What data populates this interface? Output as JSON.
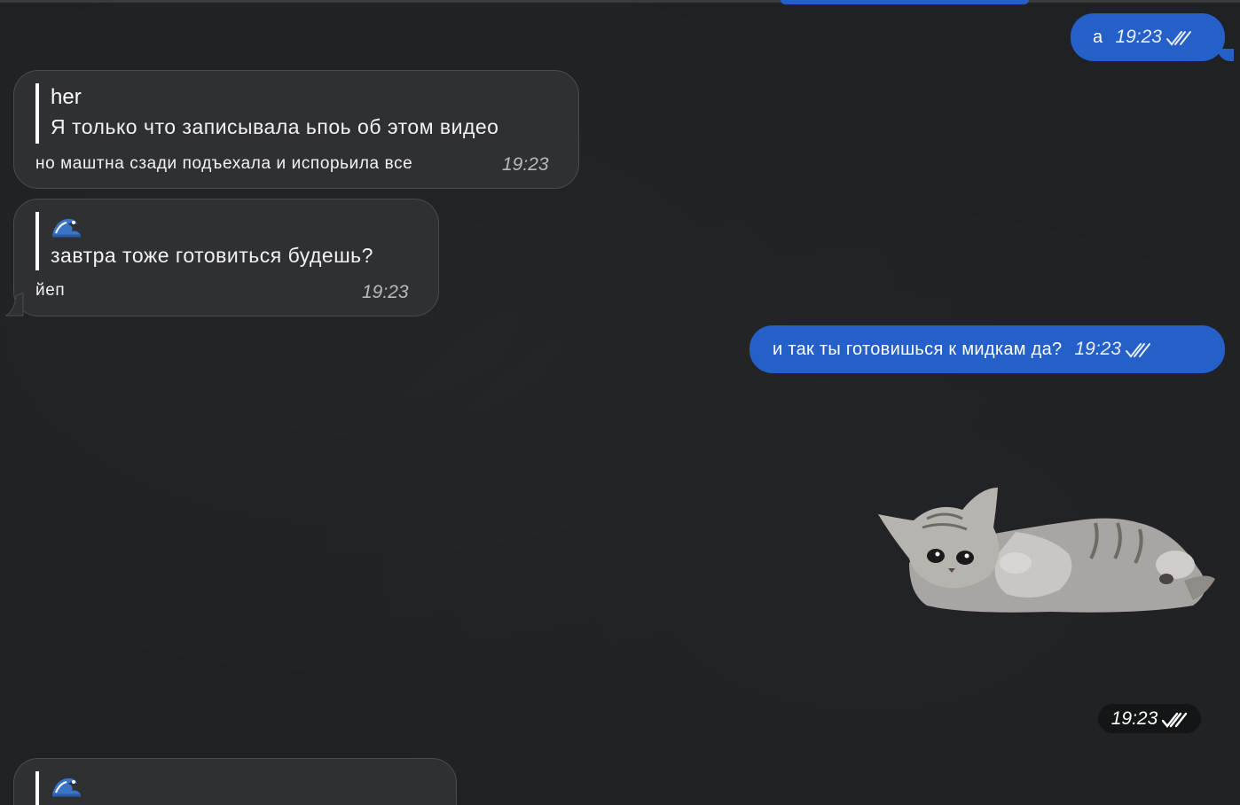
{
  "colors": {
    "background": "#1f2124",
    "outgoing_bubble": "#2460c8",
    "incoming_bubble": "#2f3033",
    "incoming_border": "#4a4b4f",
    "time_incoming": "#b8b9bd"
  },
  "messages": [
    {
      "direction": "outgoing",
      "text": "а",
      "time": "19:23",
      "status_icon": "double-check-icon"
    },
    {
      "direction": "incoming",
      "reply": {
        "author": "her",
        "text": "Я только что записывала ьпоь об этом видео"
      },
      "text": "но маштна сзади подъехала и испорьила все",
      "time": "19:23"
    },
    {
      "direction": "incoming",
      "reply": {
        "author_icon": "wave-emoji",
        "text": "завтра тоже готовиться будешь?"
      },
      "text": "йеп",
      "time": "19:23"
    },
    {
      "direction": "outgoing",
      "text": "и так ты готовишься к мидкам да?",
      "time": "19:23",
      "status_icon": "double-check-icon"
    },
    {
      "direction": "outgoing",
      "type": "sticker",
      "sticker": "kitten-lying-sticker",
      "time": "19:23",
      "status_icon": "double-check-icon"
    },
    {
      "direction": "incoming",
      "reply": {
        "author_icon": "wave-emoji"
      }
    }
  ]
}
